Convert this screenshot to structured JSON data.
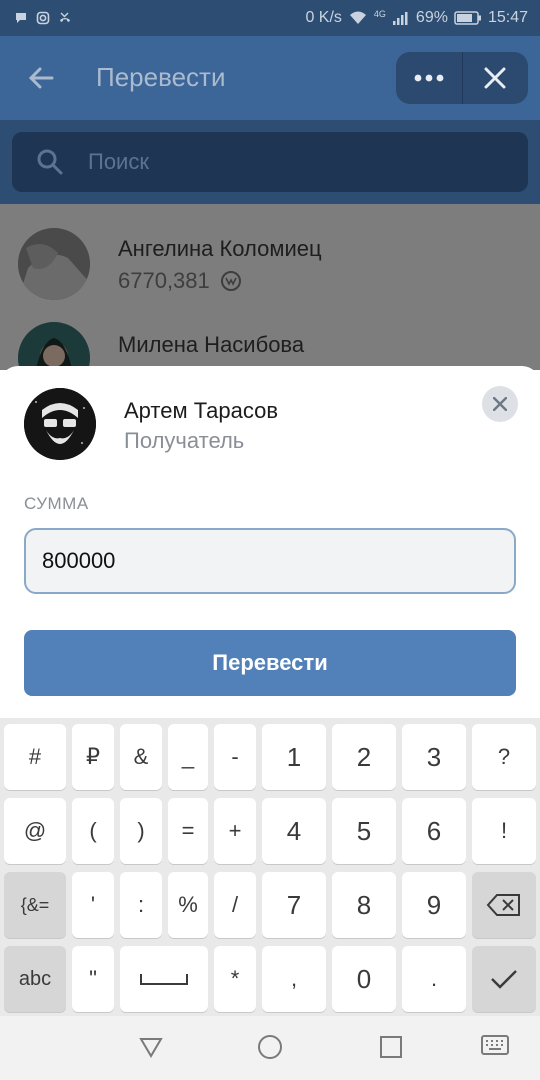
{
  "status_bar": {
    "speed": "0 K/s",
    "network": "4G",
    "battery": "69%",
    "time": "15:47",
    "icons": [
      "chat-icon",
      "instagram-icon",
      "missed-call-icon",
      "wifi-icon",
      "signal-icon",
      "battery-icon"
    ]
  },
  "header": {
    "title": "Перевести",
    "back_icon": "arrow-left-icon",
    "more_icon": "more-dots-icon",
    "close_icon": "close-icon"
  },
  "search": {
    "placeholder": "Поиск"
  },
  "contacts": [
    {
      "name": "Ангелина Коломиец",
      "balance": "6770,381",
      "currency_icon": "vk-coin-icon"
    },
    {
      "name": "Милена Насибова",
      "balance": ""
    }
  ],
  "transfer_sheet": {
    "recipient_name": "Артем Тарасов",
    "recipient_role": "Получатель",
    "amount_label": "СУММА",
    "amount_value": "800000",
    "send_label": "Перевести"
  },
  "keyboard": {
    "rows": [
      [
        "#",
        "₽",
        "&",
        "_",
        "-",
        "1",
        "2",
        "3",
        "?"
      ],
      [
        "@",
        "(",
        ")",
        "=",
        "+",
        "4",
        "5",
        "6",
        "!"
      ],
      [
        "{&=",
        "'",
        ":",
        "%",
        "/",
        "7",
        "8",
        "9",
        "⌫"
      ],
      [
        "abc",
        "\"",
        "␣",
        "*",
        ",",
        "0",
        ".",
        "✓"
      ]
    ]
  },
  "nav": {
    "icons": [
      "back-triangle-icon",
      "home-circle-icon",
      "recents-square-icon",
      "keyboard-toggle-icon"
    ]
  },
  "colors": {
    "header_bg": "#3c6598",
    "status_bg": "#2e4d72",
    "button_bg": "#5181b8",
    "sheet_bg": "#ffffff"
  }
}
